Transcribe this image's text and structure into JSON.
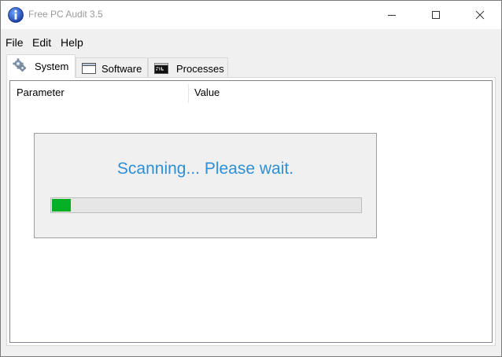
{
  "window": {
    "title": "Free PC Audit 3.5",
    "accent": "#2f8fd4"
  },
  "icons": {
    "app": "info-icon",
    "minimize": "minimize-icon",
    "maximize": "maximize-icon",
    "close": "close-icon",
    "system_tab": "gears-icon",
    "software_tab": "window-icon",
    "processes_tab": "console-icon"
  },
  "menu": {
    "items": [
      {
        "label": "File"
      },
      {
        "label": "Edit"
      },
      {
        "label": "Help"
      }
    ]
  },
  "tabs": [
    {
      "label": "System",
      "active": true
    },
    {
      "label": "Software",
      "active": false
    },
    {
      "label": "Processes",
      "active": false
    }
  ],
  "table": {
    "columns": [
      "Parameter",
      "Value"
    ]
  },
  "scan": {
    "message": "Scanning... Please wait.",
    "progress_fraction": 0.06,
    "progress_color": "#06b025"
  }
}
